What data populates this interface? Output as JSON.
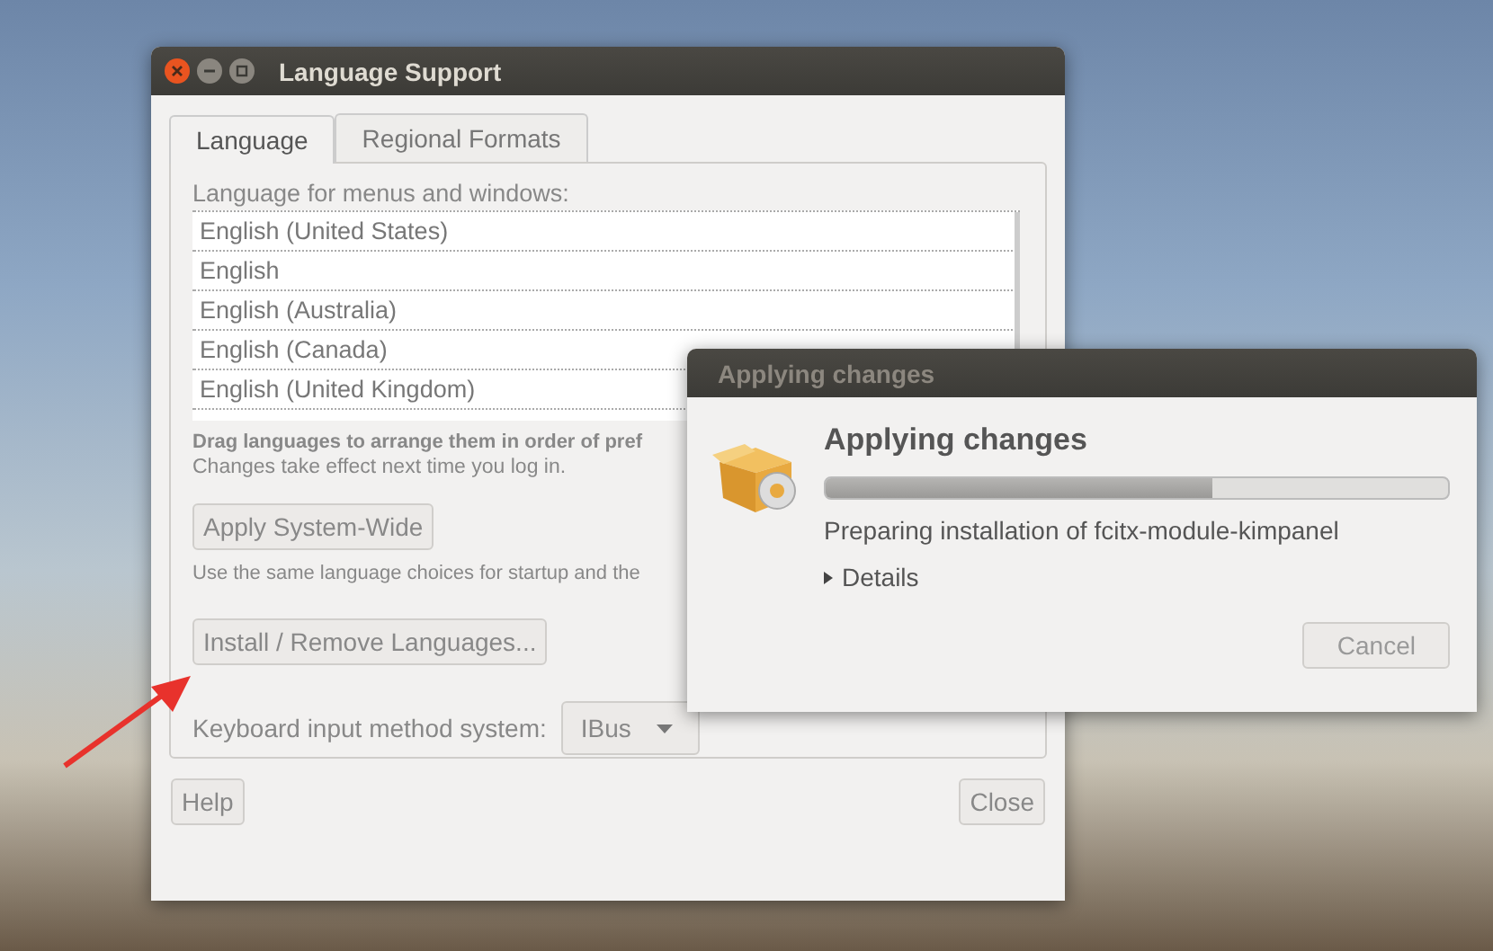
{
  "main_window": {
    "title": "Language Support",
    "tabs": [
      {
        "label": "Language",
        "selected": true
      },
      {
        "label": "Regional Formats",
        "selected": false
      }
    ],
    "list_label": "Language for menus and windows:",
    "languages": [
      "English (United States)",
      "English",
      "English (Australia)",
      "English (Canada)",
      "English (United Kingdom)"
    ],
    "drag_hint": "Drag languages to arrange them in order of pref",
    "drag_note": "Changes take effect next time you log in.",
    "apply_button": "Apply System-Wide",
    "apply_note": "Use the same language choices for startup and the",
    "install_button": "Install / Remove Languages...",
    "input_method_label": "Keyboard input method system:",
    "input_method_value": "IBus",
    "help_button": "Help",
    "close_button": "Close"
  },
  "dialog": {
    "title": "Applying changes",
    "heading": "Applying changes",
    "progress": {
      "level": 0.62
    },
    "status": "Preparing installation of fcitx-module-kimpanel",
    "details": {
      "label": "Details",
      "expanded": false
    },
    "cancel_button": "Cancel"
  }
}
